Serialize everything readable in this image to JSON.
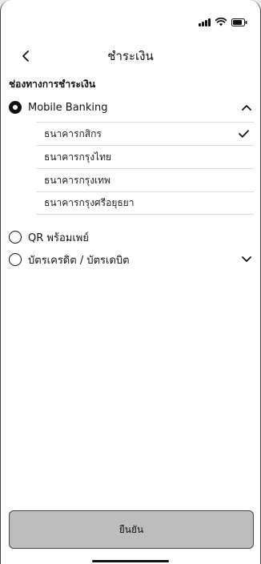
{
  "header": {
    "title": "ชำระเงิน",
    "back_icon": "chevron-left-icon"
  },
  "status_bar": {
    "icons": [
      "signal-icon",
      "wifi-icon",
      "battery-icon"
    ]
  },
  "section": {
    "title": "ช่องทางการชำระเงิน"
  },
  "payment_methods": [
    {
      "label": "Mobile Banking",
      "selected": true,
      "expanded": true,
      "chevron": "chevron-up-icon"
    },
    {
      "label": "QR พร้อมเพย์",
      "selected": false
    },
    {
      "label": "บัตรเครดิต / บัตรเดบิต",
      "selected": false,
      "expanded": false,
      "chevron": "chevron-down-icon"
    }
  ],
  "banks": [
    {
      "label": "ธนาคารกสิกร",
      "selected": true
    },
    {
      "label": "ธนาคารกรุงไทย",
      "selected": false
    },
    {
      "label": "ธนาคารกรุงเทพ",
      "selected": false
    },
    {
      "label": "ธนาคารกรุงศรีอยุธยา",
      "selected": false
    }
  ],
  "confirm": {
    "label": "ยืนยัน"
  },
  "colors": {
    "background": "#ffffff",
    "button_bg": "#bdbdbd",
    "divider": "#dcdcdc",
    "text": "#111111"
  }
}
